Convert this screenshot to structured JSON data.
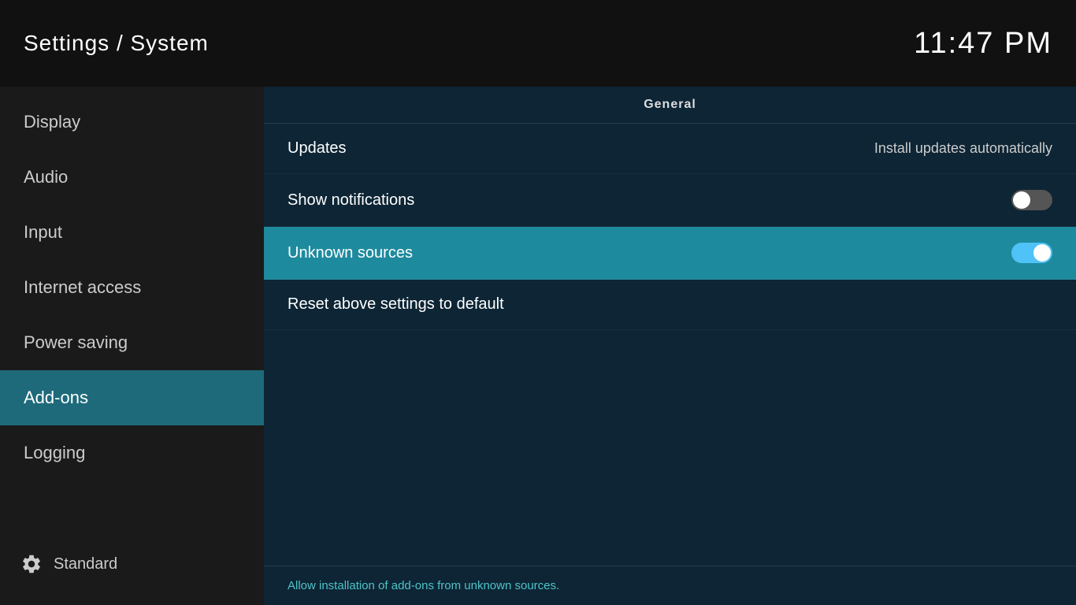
{
  "header": {
    "title": "Settings / System",
    "time": "11:47 PM"
  },
  "sidebar": {
    "items": [
      {
        "id": "display",
        "label": "Display",
        "active": false
      },
      {
        "id": "audio",
        "label": "Audio",
        "active": false
      },
      {
        "id": "input",
        "label": "Input",
        "active": false
      },
      {
        "id": "internet-access",
        "label": "Internet access",
        "active": false
      },
      {
        "id": "power-saving",
        "label": "Power saving",
        "active": false
      },
      {
        "id": "add-ons",
        "label": "Add-ons",
        "active": true
      },
      {
        "id": "logging",
        "label": "Logging",
        "active": false
      }
    ],
    "footer": {
      "label": "Standard"
    }
  },
  "content": {
    "section_header": "General",
    "rows": [
      {
        "id": "updates",
        "label": "Updates",
        "value": "Install updates automatically",
        "toggle": null,
        "highlighted": false
      },
      {
        "id": "show-notifications",
        "label": "Show notifications",
        "value": null,
        "toggle": "off",
        "highlighted": false
      },
      {
        "id": "unknown-sources",
        "label": "Unknown sources",
        "value": null,
        "toggle": "on",
        "highlighted": true
      },
      {
        "id": "reset-settings",
        "label": "Reset above settings to default",
        "value": null,
        "toggle": null,
        "highlighted": false
      }
    ],
    "footer_hint": "Allow installation of add-ons from unknown sources."
  }
}
